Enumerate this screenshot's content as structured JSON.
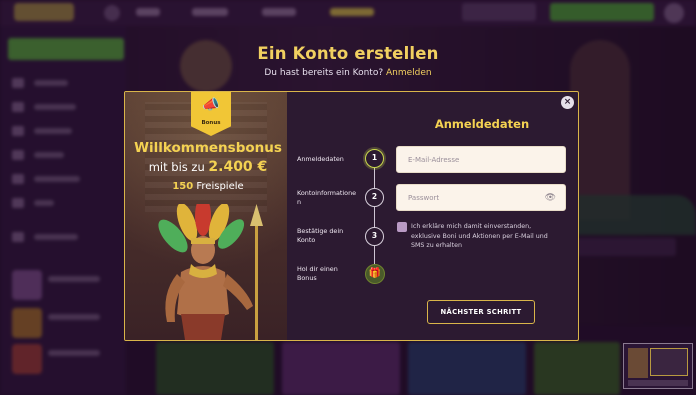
{
  "background": {
    "title": "Ein Konto erstellen",
    "subtitle": "Du hast bereits ein Konto?",
    "login_link": "Anmelden"
  },
  "modal": {
    "bonus_tag": "Bonus",
    "welcome_title": "Willkommensbonus",
    "welcome_prefix": "mit bis zu",
    "welcome_amount": "2.400 €",
    "freespins_count": "150",
    "freespins_label": "Freispiele",
    "steps": [
      {
        "number": "1",
        "label": "Anmeldedaten",
        "active": true
      },
      {
        "number": "2",
        "label": "Kontoinformatione n"
      },
      {
        "number": "3",
        "label": "Bestätige dein Konto"
      },
      {
        "icon": "gift-icon",
        "label": "Hol dir einen Bonus"
      }
    ],
    "form": {
      "title": "Anmeldedaten",
      "email_placeholder": "E-Mail-Adresse",
      "password_placeholder": "Passwort",
      "consent_text": "Ich erkläre mich damit einverstanden, exklusive Boni und Aktionen per E-Mail und SMS zu erhalten",
      "next_button": "NÄCHSTER SCHRITT"
    }
  },
  "colors": {
    "accent_gold": "#f4d252",
    "background": "#2a1133",
    "modal_bg": "#2c1a31",
    "step_active": "#c9d94c"
  }
}
